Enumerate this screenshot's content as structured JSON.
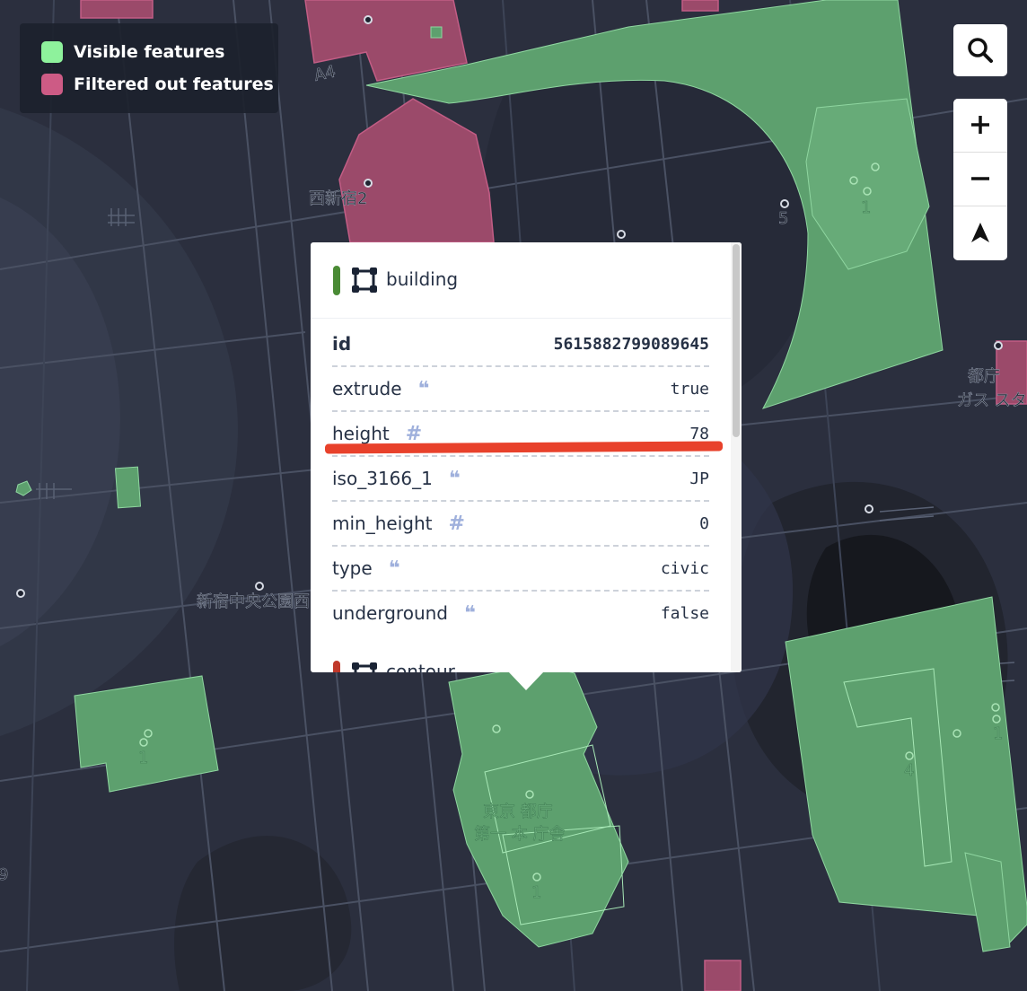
{
  "legend": {
    "visible": {
      "label": "Visible features",
      "color": "#8ef29c"
    },
    "filtered": {
      "label": "Filtered out features",
      "color": "#cd5b85"
    }
  },
  "controls": {
    "search_icon": "search-icon",
    "zoom_in_icon": "plus-icon",
    "zoom_out_icon": "minus-icon",
    "compass_icon": "compass-arrow-icon"
  },
  "map_labels": {
    "block_a4": "A4",
    "nishishinjuku2": "西新宿2",
    "num5": "5",
    "num1_top": "1",
    "park": "新宿中央公園西",
    "toei_line1": "都庁",
    "toei_line2": "ガス スタ",
    "tocho1": "東京 都庁",
    "tocho2": "第一 本 庁舎",
    "num1_bottom": "1",
    "num1_left": "1",
    "num4": "4",
    "num1_right": "1",
    "num9": "9"
  },
  "popup": {
    "layers": [
      {
        "name": "building",
        "color": "#4a8b35"
      },
      {
        "name": "contour",
        "color": "#c0392b"
      }
    ],
    "properties": [
      {
        "key": "id",
        "value": "5615882799089645",
        "type": "",
        "bold": true
      },
      {
        "key": "extrude",
        "value": "true",
        "type": "string"
      },
      {
        "key": "height",
        "value": "78",
        "type": "number"
      },
      {
        "key": "iso_3166_1",
        "value": "JP",
        "type": "string"
      },
      {
        "key": "min_height",
        "value": "0",
        "type": "number"
      },
      {
        "key": "type",
        "value": "civic",
        "type": "string"
      },
      {
        "key": "underground",
        "value": "false",
        "type": "string"
      }
    ]
  }
}
